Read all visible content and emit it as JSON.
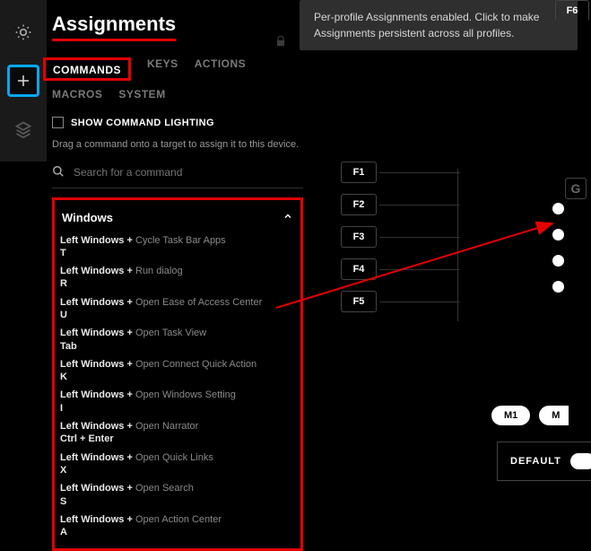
{
  "title": "Assignments",
  "tooltip": "Per-profile Assignments enabled. Click to make Assignments persistent across all profiles.",
  "tabs_row1": [
    "COMMANDS",
    "KEYS",
    "ACTIONS"
  ],
  "tabs_row2": [
    "MACROS",
    "SYSTEM"
  ],
  "active_tab": "COMMANDS",
  "show_lighting_label": "SHOW COMMAND LIGHTING",
  "hint": "Drag a command onto a target to assign it to this device.",
  "search_placeholder": "Search for a command",
  "group_name": "Windows",
  "commands": [
    {
      "key": "Left Windows + T",
      "desc": "Cycle Task Bar Apps"
    },
    {
      "key": "Left Windows + R",
      "desc": "Run dialog"
    },
    {
      "key": "Left Windows + U",
      "desc": "Open Ease of Access Center"
    },
    {
      "key": "Left Windows + Tab",
      "desc": "Open Task View"
    },
    {
      "key": "Left Windows + K",
      "desc": "Open Connect Quick Action"
    },
    {
      "key": "Left Windows + I",
      "desc": "Open Windows Setting"
    },
    {
      "key": "Left Windows + Ctrl + Enter",
      "desc": "Open Narrator"
    },
    {
      "key": "Left Windows + X",
      "desc": "Open Quick Links"
    },
    {
      "key": "Left Windows + S",
      "desc": "Open Search"
    },
    {
      "key": "Left Windows + A",
      "desc": "Open Action Center"
    }
  ],
  "fkeys": [
    "F1",
    "F2",
    "F3",
    "F4",
    "F5"
  ],
  "f6": "F6",
  "m1_label": "M1",
  "m_label": "M",
  "default_label": "DEFAULT",
  "logo": "G"
}
